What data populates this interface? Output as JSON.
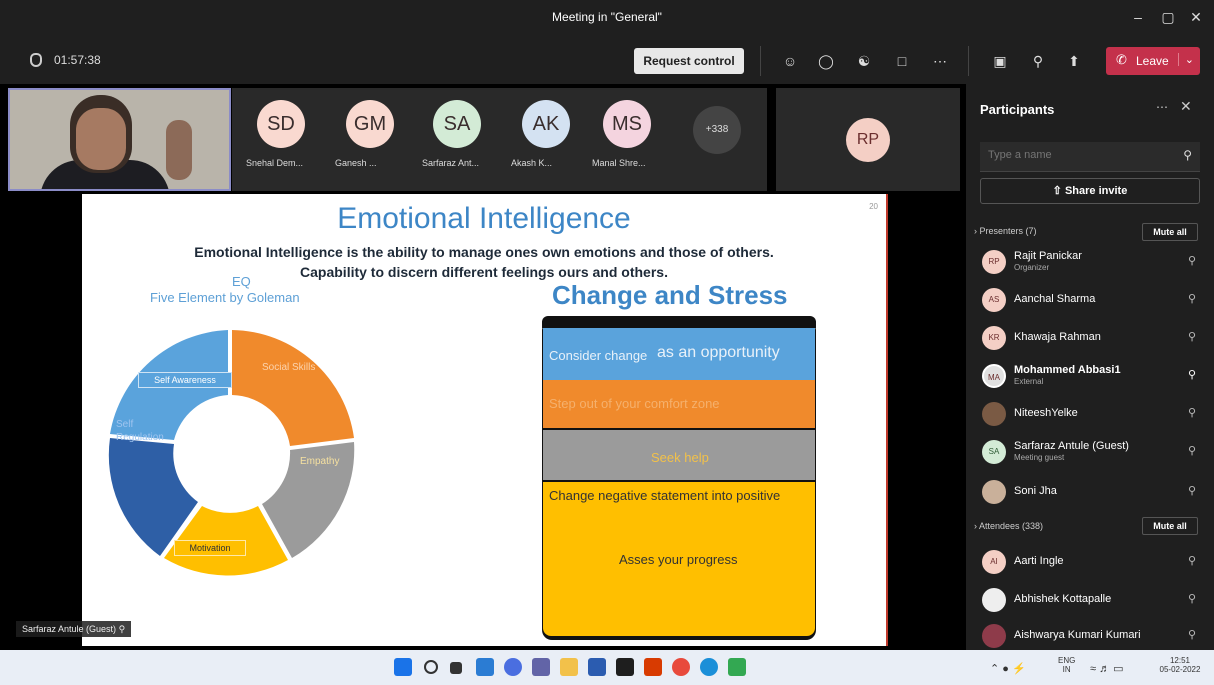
{
  "window": {
    "title": "Meeting in \"General\""
  },
  "toolbar": {
    "timer": "01:57:38",
    "request_control": "Request control",
    "leave": "Leave",
    "leave_color": "#c4314b",
    "icons": [
      "people-icon",
      "chat-icon",
      "reactions-icon",
      "rooms-icon",
      "more-icon",
      "camera-icon",
      "mic-icon",
      "share-icon"
    ]
  },
  "strip": {
    "participants": [
      {
        "initials": "SD",
        "name": "Snehal Dem...",
        "color": "#f9d9d0"
      },
      {
        "initials": "GM",
        "name": "Ganesh ...",
        "color": "#f9d9d0"
      },
      {
        "initials": "SA",
        "name": "Sarfaraz Ant...",
        "color": "#d3ebd6"
      },
      {
        "initials": "AK",
        "name": "Akash K...",
        "color": "#d4e2f2"
      },
      {
        "initials": "MS",
        "name": "Manal Shre...",
        "color": "#f4d4df"
      }
    ],
    "more_count": "+338",
    "rp_tile": "RP"
  },
  "slide": {
    "title": "Emotional Intelligence",
    "number": "20",
    "line1": "Emotional Intelligence is the ability to manage ones own emotions and those of others.",
    "line2": "Capability to discern different feelings ours and others.",
    "eq": "EQ",
    "five_elements": "Five Element by Goleman",
    "cycle": [
      "Self Awareness",
      "Social Skills",
      "Empathy",
      "Motivation",
      "Self Regulation"
    ],
    "cs_title": "Change and Stress",
    "layers": [
      {
        "text_a": "Consider change",
        "text_b": "as an opportunity",
        "color": "#5aa3dc"
      },
      {
        "text_a": "Step out of your comfort zone",
        "color": "#f08a2c"
      },
      {
        "text_a": "Seek help",
        "color": "#9b9b9b"
      },
      {
        "text_a": "Change negative statement into positive",
        "text_b": "Asses your progress",
        "color": "#ffbf00"
      }
    ]
  },
  "panel": {
    "title": "Participants",
    "search_placeholder": "Type a name",
    "share_invite": "Share invite",
    "presenters_header": "Presenters (7)",
    "attendees_header": "Attendees (338)",
    "mute_all": "Mute all",
    "presenters": [
      {
        "initials": "RP",
        "name": "Rajit Panickar",
        "role": "Organizer"
      },
      {
        "initials": "AS",
        "name": "Aanchal Sharma",
        "role": ""
      },
      {
        "initials": "KR",
        "name": "Khawaja Rahman",
        "role": ""
      },
      {
        "initials": "MA",
        "name": "Mohammed Abbasi1",
        "role": "External"
      },
      {
        "initials": "",
        "name": "NiteeshYelke",
        "role": ""
      },
      {
        "initials": "SA",
        "name": "Sarfaraz Antule (Guest)",
        "role": "Meeting guest"
      },
      {
        "initials": "",
        "name": "Soni Jha",
        "role": ""
      }
    ],
    "attendees": [
      {
        "initials": "AI",
        "name": "Aarti Ingle"
      },
      {
        "initials": "",
        "name": "Abhishek Kottapalle"
      },
      {
        "initials": "",
        "name": "Aishwarya Kumari Kumari"
      }
    ]
  },
  "nametag": "Sarfaraz Antule (Guest)",
  "taskbar": {
    "lang": "ENG",
    "region": "IN",
    "time": "12:51",
    "date": "05-02-2022"
  }
}
